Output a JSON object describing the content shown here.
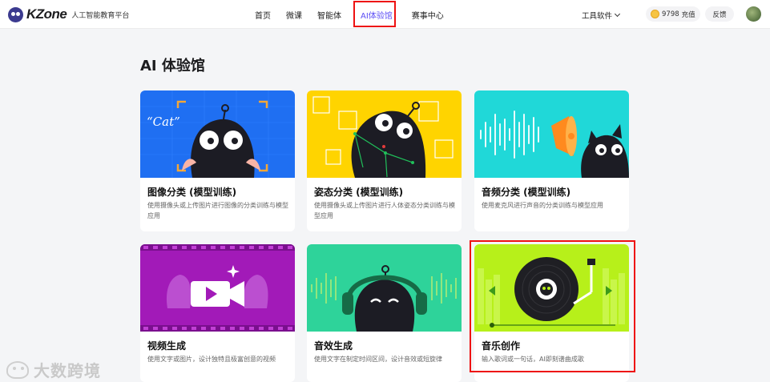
{
  "brand": {
    "name": "KZone",
    "subtitle": "人工智能教育平台"
  },
  "nav": {
    "items": [
      {
        "label": "首页",
        "active": false
      },
      {
        "label": "微课",
        "active": false
      },
      {
        "label": "智能体",
        "active": false
      },
      {
        "label": "AI体验馆",
        "active": true
      },
      {
        "label": "赛事中心",
        "active": false
      }
    ]
  },
  "header": {
    "tools_label": "工具软件",
    "coin_count": "9798",
    "recharge_label": "充值",
    "feedback_label": "反馈"
  },
  "page": {
    "title": "AI 体验馆"
  },
  "cards": [
    {
      "title": "图像分类 (模型训练)",
      "desc": "使用摄像头或上传图片进行图像的分类训练与模型应用",
      "thumb_text": "“Cat”"
    },
    {
      "title": "姿态分类 (模型训练)",
      "desc": "使用摄像头或上传图片进行人体姿态分类训练与模型应用"
    },
    {
      "title": "音频分类 (模型训练)",
      "desc": "使用麦克风进行声音的分类训练与模型应用"
    },
    {
      "title": "视频生成",
      "desc": "使用文字或图片，设计独特且极富创意的视频"
    },
    {
      "title": "音效生成",
      "desc": "使用文字在制定时间区间，设计音效或短旋律"
    },
    {
      "title": "音乐创作",
      "desc": "输入歌词或一句话，AI即刻谱曲成歌"
    }
  ],
  "watermark": {
    "text": "大数跨境"
  },
  "colors": {
    "accent": "#5b4df5",
    "highlight": "#e11111",
    "card1_bg": "#1f6ff2",
    "card2_bg": "#ffd400",
    "card3_bg": "#20d8d8",
    "card4_bg": "#a21ab8",
    "card5_bg": "#2ed39a",
    "card6_bg": "#b7f01a"
  }
}
